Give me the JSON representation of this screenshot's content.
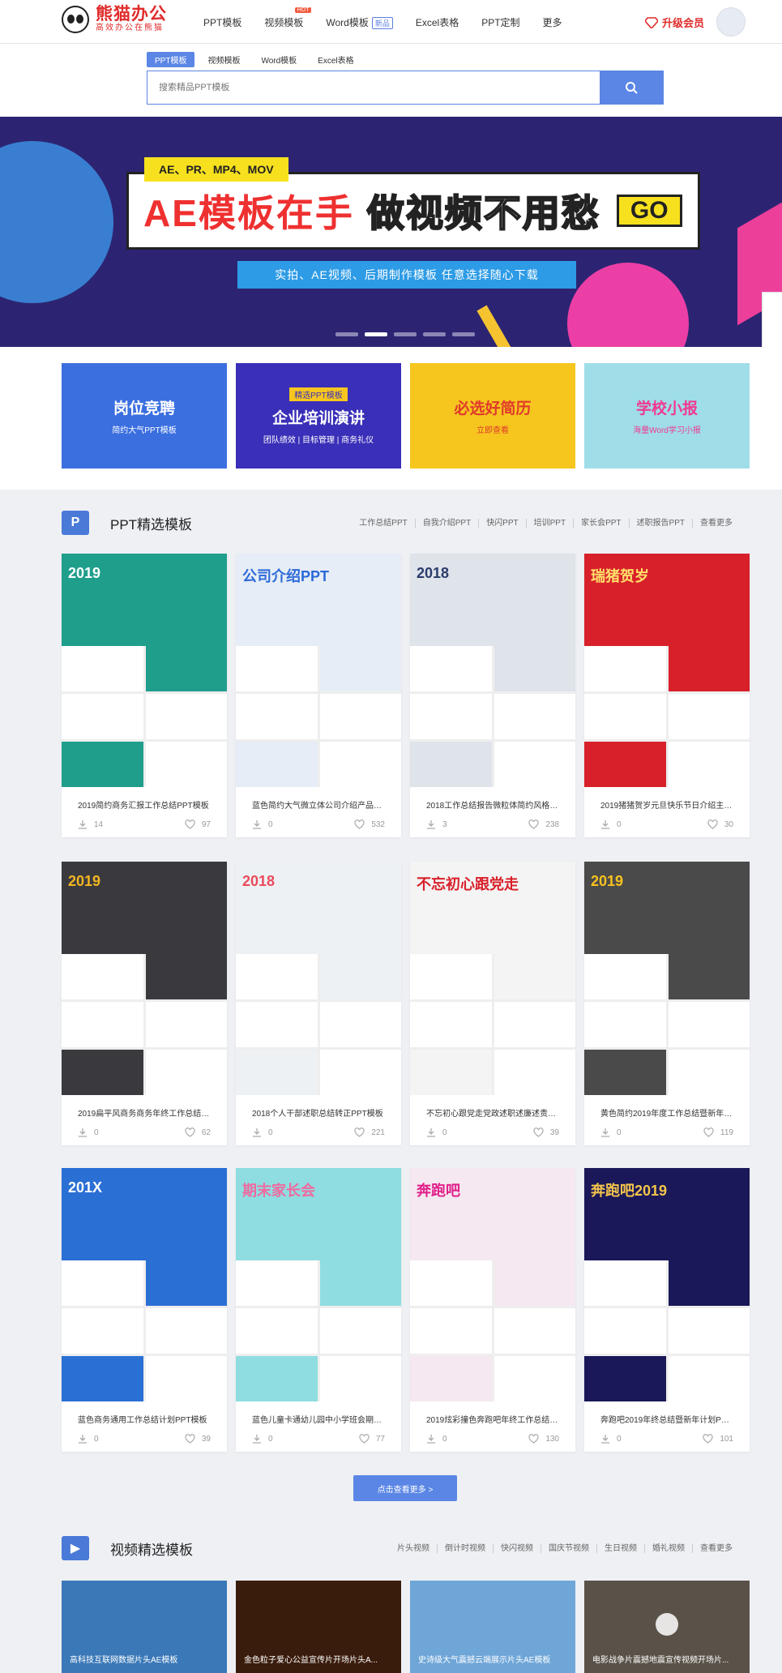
{
  "header": {
    "logo_name": "熊猫办公",
    "logo_sub": "高效办公在熊猫",
    "nav": [
      {
        "label": "PPT模板"
      },
      {
        "label": "视频模板",
        "badge": "HOT"
      },
      {
        "label": "Word模板",
        "tag": "新品"
      },
      {
        "label": "Excel表格"
      },
      {
        "label": "PPT定制"
      },
      {
        "label": "更多"
      }
    ],
    "upgrade_label": "升级会员"
  },
  "search": {
    "tabs": [
      "PPT模板",
      "视频模板",
      "Word模板",
      "Excel表格"
    ],
    "placeholder": "搜索精品PPT模板"
  },
  "banner": {
    "top_label": "AE、PR、MP4、MOV",
    "title_red": "AE模板在手",
    "title_white": "做视频不用愁",
    "go": "GO",
    "subtitle": "实拍、AE视频、后期制作模板  任意选择随心下载"
  },
  "promos": [
    {
      "title": "岗位竞聘",
      "sub": "简约大气PPT模板",
      "bg": "#3b6fe0",
      "fg": "#ffffff"
    },
    {
      "title": "企业培训演讲",
      "sub": "团队绩效 | 目标管理 | 商务礼仪",
      "tag": "精选PPT模板",
      "bg": "#3a2fb8",
      "fg": "#ffffff"
    },
    {
      "title": "必选好简历",
      "sub": "立即查看",
      "bg": "#f6c61f",
      "fg": "#e03a2b"
    },
    {
      "title": "学校小报",
      "sub": "海量Word学习小报",
      "bg": "#9fdde8",
      "fg": "#f0398f"
    }
  ],
  "ppt_section": {
    "title": "PPT精选模板",
    "tags": [
      "工作总结PPT",
      "自我介绍PPT",
      "快闪PPT",
      "培训PPT",
      "家长会PPT",
      "述职报告PPT",
      "查看更多"
    ],
    "cards": [
      {
        "title": "2019简约商务汇报工作总结PPT模板",
        "downloads": "14",
        "likes": "97",
        "thumb_text": "2019",
        "bg": "#1f9e8c",
        "fg": "#ffffff"
      },
      {
        "title": "蓝色简约大气微立体公司介绍产品介...",
        "downloads": "0",
        "likes": "532",
        "thumb_text": "公司介绍PPT",
        "bg": "#e6edf6",
        "fg": "#2d6ad8"
      },
      {
        "title": "2018工作总结报告微粒体简约风格PP...",
        "downloads": "3",
        "likes": "238",
        "thumb_text": "2018",
        "bg": "#dfe3ea",
        "fg": "#2a3c6b"
      },
      {
        "title": "2019猪猪贺岁元旦快乐节日介绍主题...",
        "downloads": "0",
        "likes": "30",
        "thumb_text": "瑞猪贺岁",
        "bg": "#d8202a",
        "fg": "#ffe06a"
      },
      {
        "title": "2019扁平风商务商务年终工作总结暨...",
        "downloads": "0",
        "likes": "62",
        "thumb_text": "2019",
        "bg": "#3a3a3e",
        "fg": "#f4b621"
      },
      {
        "title": "2018个人干部述职总结转正PPT模板",
        "downloads": "0",
        "likes": "221",
        "thumb_text": "2018",
        "bg": "#eef1f4",
        "fg": "#e94b5b"
      },
      {
        "title": "不忘初心跟党走党政述职述廉述责工...",
        "downloads": "0",
        "likes": "39",
        "thumb_text": "不忘初心跟党走",
        "bg": "#f4f4f4",
        "fg": "#d8202a"
      },
      {
        "title": "黄色简约2019年度工作总结暨新年计...",
        "downloads": "0",
        "likes": "119",
        "thumb_text": "2019",
        "bg": "#4a4a4a",
        "fg": "#f7c21e"
      },
      {
        "title": "蓝色商务通用工作总结计划PPT模板",
        "downloads": "0",
        "likes": "39",
        "thumb_text": "201X",
        "bg": "#2a6fd4",
        "fg": "#ffffff"
      },
      {
        "title": "蓝色儿童卡通幼儿园中小学班会期末...",
        "downloads": "0",
        "likes": "77",
        "thumb_text": "期末家长会",
        "bg": "#8fdde0",
        "fg": "#f06aa0"
      },
      {
        "title": "2019炫彩撞色奔跑吧年终工作总结暨...",
        "downloads": "0",
        "likes": "130",
        "thumb_text": "奔跑吧",
        "bg": "#f5e8f0",
        "fg": "#e0208a"
      },
      {
        "title": "奔跑吧2019年终总结暨新年计划PPT...",
        "downloads": "0",
        "likes": "101",
        "thumb_text": "奔跑吧2019",
        "bg": "#1a1858",
        "fg": "#f4c44c"
      }
    ],
    "more_label": "点击查看更多 >"
  },
  "video_section": {
    "title": "视频精选模板",
    "tags": [
      "片头视频",
      "倒计时视频",
      "快闪视频",
      "国庆节视频",
      "生日视频",
      "婚礼视频",
      "查看更多"
    ],
    "cards": [
      {
        "caption": "高科技互联网数据片头AE模板",
        "bg": "#3a78b8"
      },
      {
        "caption": "金色粒子爱心公益宣传片开场片头A...",
        "bg": "#3a1c0c"
      },
      {
        "caption": "史诗级大气震撼云端展示片头AE模板",
        "bg": "#6fa6d8"
      },
      {
        "caption": "电影战争片震撼地震宣传视频开场片...",
        "bg": "#5a5248"
      }
    ]
  }
}
